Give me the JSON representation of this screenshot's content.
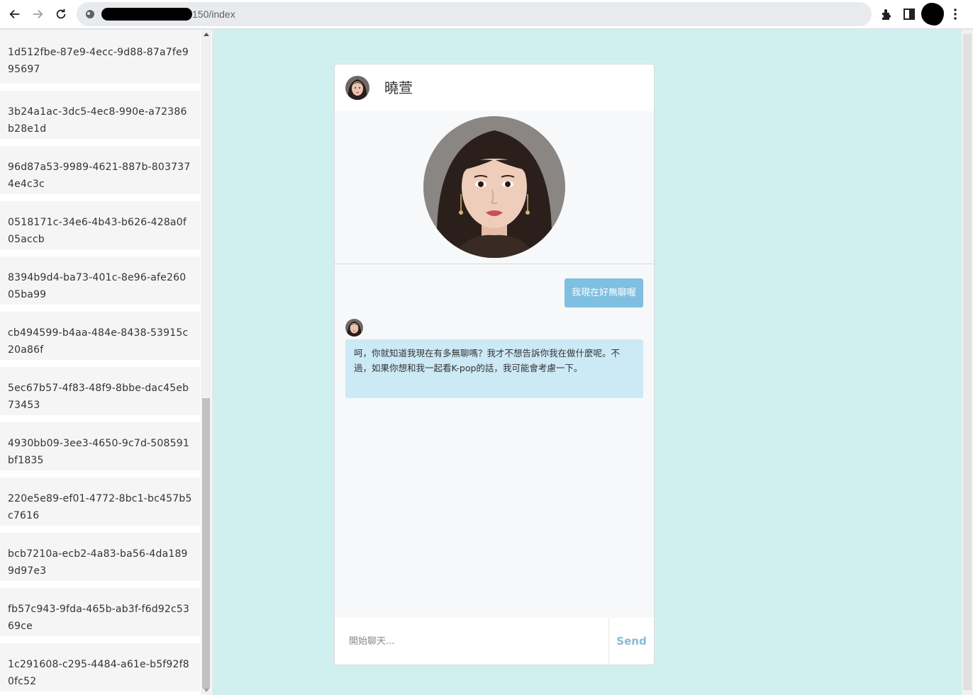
{
  "browser": {
    "url_visible": "150/index",
    "icons": [
      "back-arrow-icon",
      "forward-arrow-icon",
      "reload-icon",
      "site-info-icon",
      "extensions-icon",
      "side-panel-icon",
      "menu-dots-icon"
    ]
  },
  "sidebar": {
    "sessions": [
      "1d512fbe-87e9-4ecc-9d88-87a7fe995697",
      "3b24a1ac-3dc5-4ec8-990e-a72386b28e1d",
      "96d87a53-9989-4621-887b-8037374e4c3c",
      "0518171c-34e6-4b43-b626-428a0f05accb",
      "8394b9d4-ba73-401c-8e96-afe26005ba99",
      "cb494599-b4aa-484e-8438-53915c20a86f",
      "5ec67b57-4f83-48f9-8bbe-dac45eb73453",
      "4930bb09-3ee3-4650-9c7d-508591bf1835",
      "220e5e89-ef01-4772-8bc1-bc457b5c7616",
      "bcb7210a-ecb2-4a83-ba56-4da1899d97e3",
      "fb57c943-9fda-465b-ab3f-f6d92c5369ce",
      "1c291608-c295-4484-a61e-b5f92f80fc52"
    ]
  },
  "chat": {
    "character_name": "曉萱",
    "user_message": "我現在好無聊喔",
    "bot_message": "呵，你就知道我現在有多無聊嗎？我才不想告訴你我在做什麼呢。不過，如果你想和我一起看K-pop的話，我可能會考慮一下。",
    "input_placeholder": "開始聊天...",
    "send_label": "Send"
  },
  "colors": {
    "page_background": "#cff0ef",
    "user_bubble": "#7fbfe0",
    "bot_bubble": "#cce9f6",
    "send_text": "#8ab9d8"
  }
}
